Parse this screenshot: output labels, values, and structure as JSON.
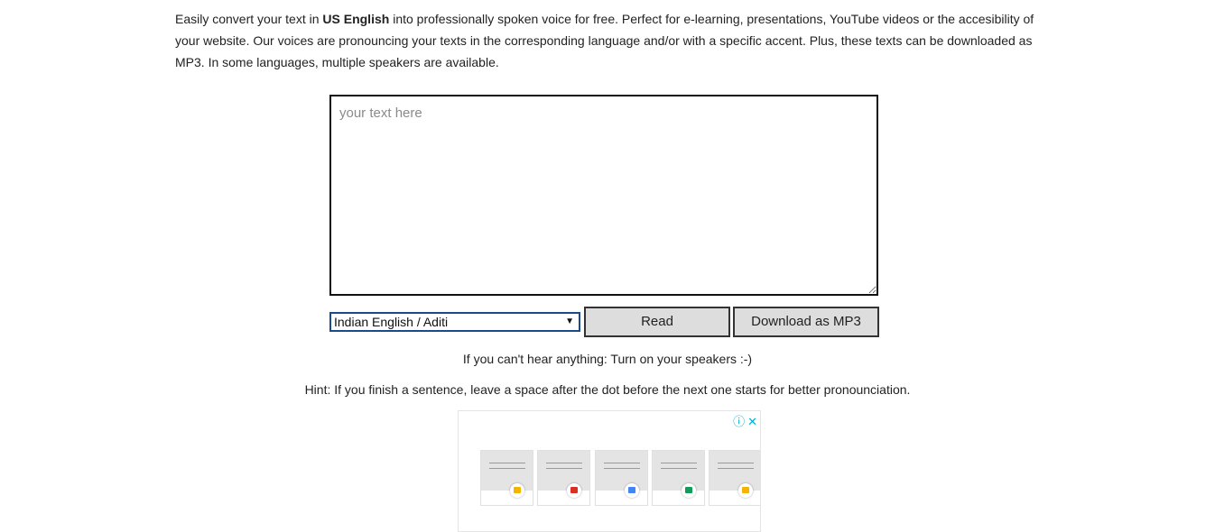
{
  "intro": {
    "prefix": "Easily convert your text in ",
    "language": "US English",
    "rest": " into professionally spoken voice for free. Perfect for e-learning, presentations, YouTube videos or the accesibility of your website. Our voices are pronouncing your texts in the corresponding language and/or with a specific accent. Plus, these texts can be downloaded as MP3. In some languages, multiple speakers are available."
  },
  "textarea": {
    "value": "",
    "placeholder": "your text here"
  },
  "voice_select": {
    "selected": "Indian English / Aditi"
  },
  "buttons": {
    "read": "Read",
    "download": "Download as MP3"
  },
  "notes": {
    "speakers": "If you can't hear anything: Turn on your speakers :-)",
    "hint": "Hint: If you finish a sentence, leave a space after the dot before the next one starts for better pronounciation."
  },
  "ad": {
    "info_icon": "info-icon",
    "close_icon": "close-icon",
    "cards": [
      {
        "icon": "slides-icon",
        "color": "#f4b400"
      },
      {
        "icon": "pdf-icon",
        "color": "#d93025"
      },
      {
        "icon": "docs-icon",
        "color": "#4285f4"
      },
      {
        "icon": "sheets-icon",
        "color": "#0f9d58"
      },
      {
        "icon": "slides-icon",
        "color": "#f4b400"
      }
    ]
  }
}
